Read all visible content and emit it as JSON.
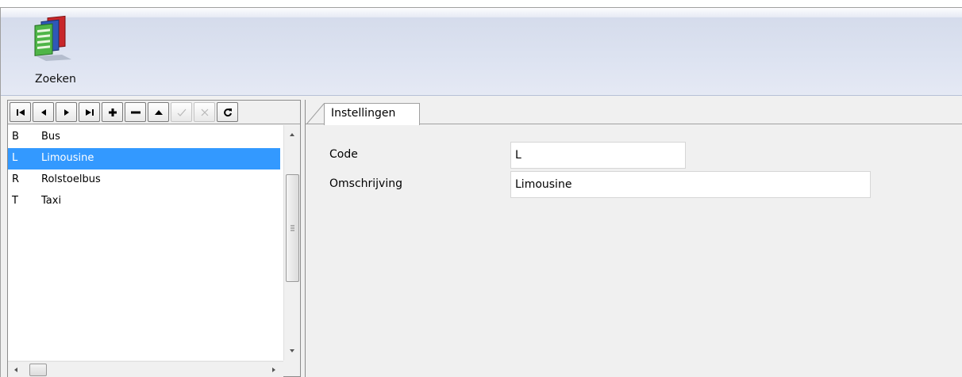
{
  "toolbar": {
    "search_label": "Zoeken",
    "search_icon": "search-files-icon"
  },
  "navigator": {
    "buttons": [
      {
        "name": "first-record-button",
        "icon": "first-icon",
        "enabled": true
      },
      {
        "name": "prior-record-button",
        "icon": "prior-icon",
        "enabled": true
      },
      {
        "name": "next-record-button",
        "icon": "next-icon",
        "enabled": true
      },
      {
        "name": "last-record-button",
        "icon": "last-icon",
        "enabled": true
      },
      {
        "name": "insert-record-button",
        "icon": "plus-icon",
        "enabled": true
      },
      {
        "name": "delete-record-button",
        "icon": "minus-icon",
        "enabled": true
      },
      {
        "name": "edit-record-button",
        "icon": "triangle-up-icon",
        "enabled": true
      },
      {
        "name": "post-record-button",
        "icon": "check-icon",
        "enabled": false
      },
      {
        "name": "cancel-record-button",
        "icon": "cancel-icon",
        "enabled": false
      },
      {
        "name": "refresh-record-button",
        "icon": "refresh-icon",
        "enabled": true
      }
    ]
  },
  "list": {
    "rows": [
      {
        "code": "B",
        "description": "Bus",
        "selected": false
      },
      {
        "code": "L",
        "description": "Limousine",
        "selected": true
      },
      {
        "code": "R",
        "description": "Rolstoelbus",
        "selected": false
      },
      {
        "code": "T",
        "description": "Taxi",
        "selected": false
      }
    ],
    "selection_color": "#3399ff"
  },
  "tabs": [
    {
      "label": "Instellingen",
      "active": true
    }
  ],
  "form": {
    "code_label": "Code",
    "code_value": "L",
    "description_label": "Omschrijving",
    "description_value": "Limousine"
  }
}
